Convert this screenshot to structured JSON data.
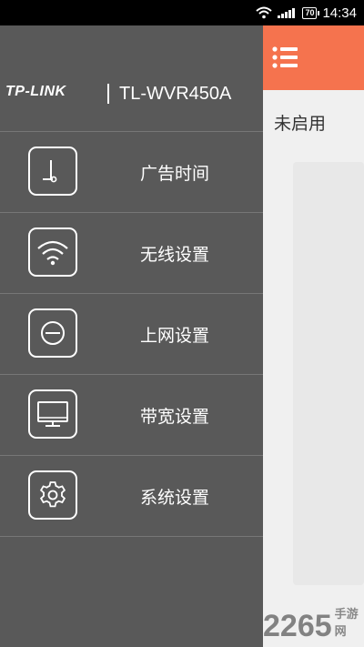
{
  "status_bar": {
    "time": "14:34",
    "battery": "70"
  },
  "brand": {
    "logo": "TP-LINK",
    "model": "TL-WVR450A"
  },
  "menu": {
    "items": [
      {
        "label": "广告时间",
        "icon": "clock-icon"
      },
      {
        "label": "无线设置",
        "icon": "wifi-icon"
      },
      {
        "label": "上网设置",
        "icon": "internet-icon"
      },
      {
        "label": "带宽设置",
        "icon": "monitor-icon"
      },
      {
        "label": "系统设置",
        "icon": "gear-icon"
      }
    ]
  },
  "main": {
    "status": "未启用"
  },
  "watermark": {
    "number": "2265",
    "text": "手游网"
  },
  "colors": {
    "drawer": "#595959",
    "accent": "#f5734e",
    "background": "#f0f0f0"
  }
}
